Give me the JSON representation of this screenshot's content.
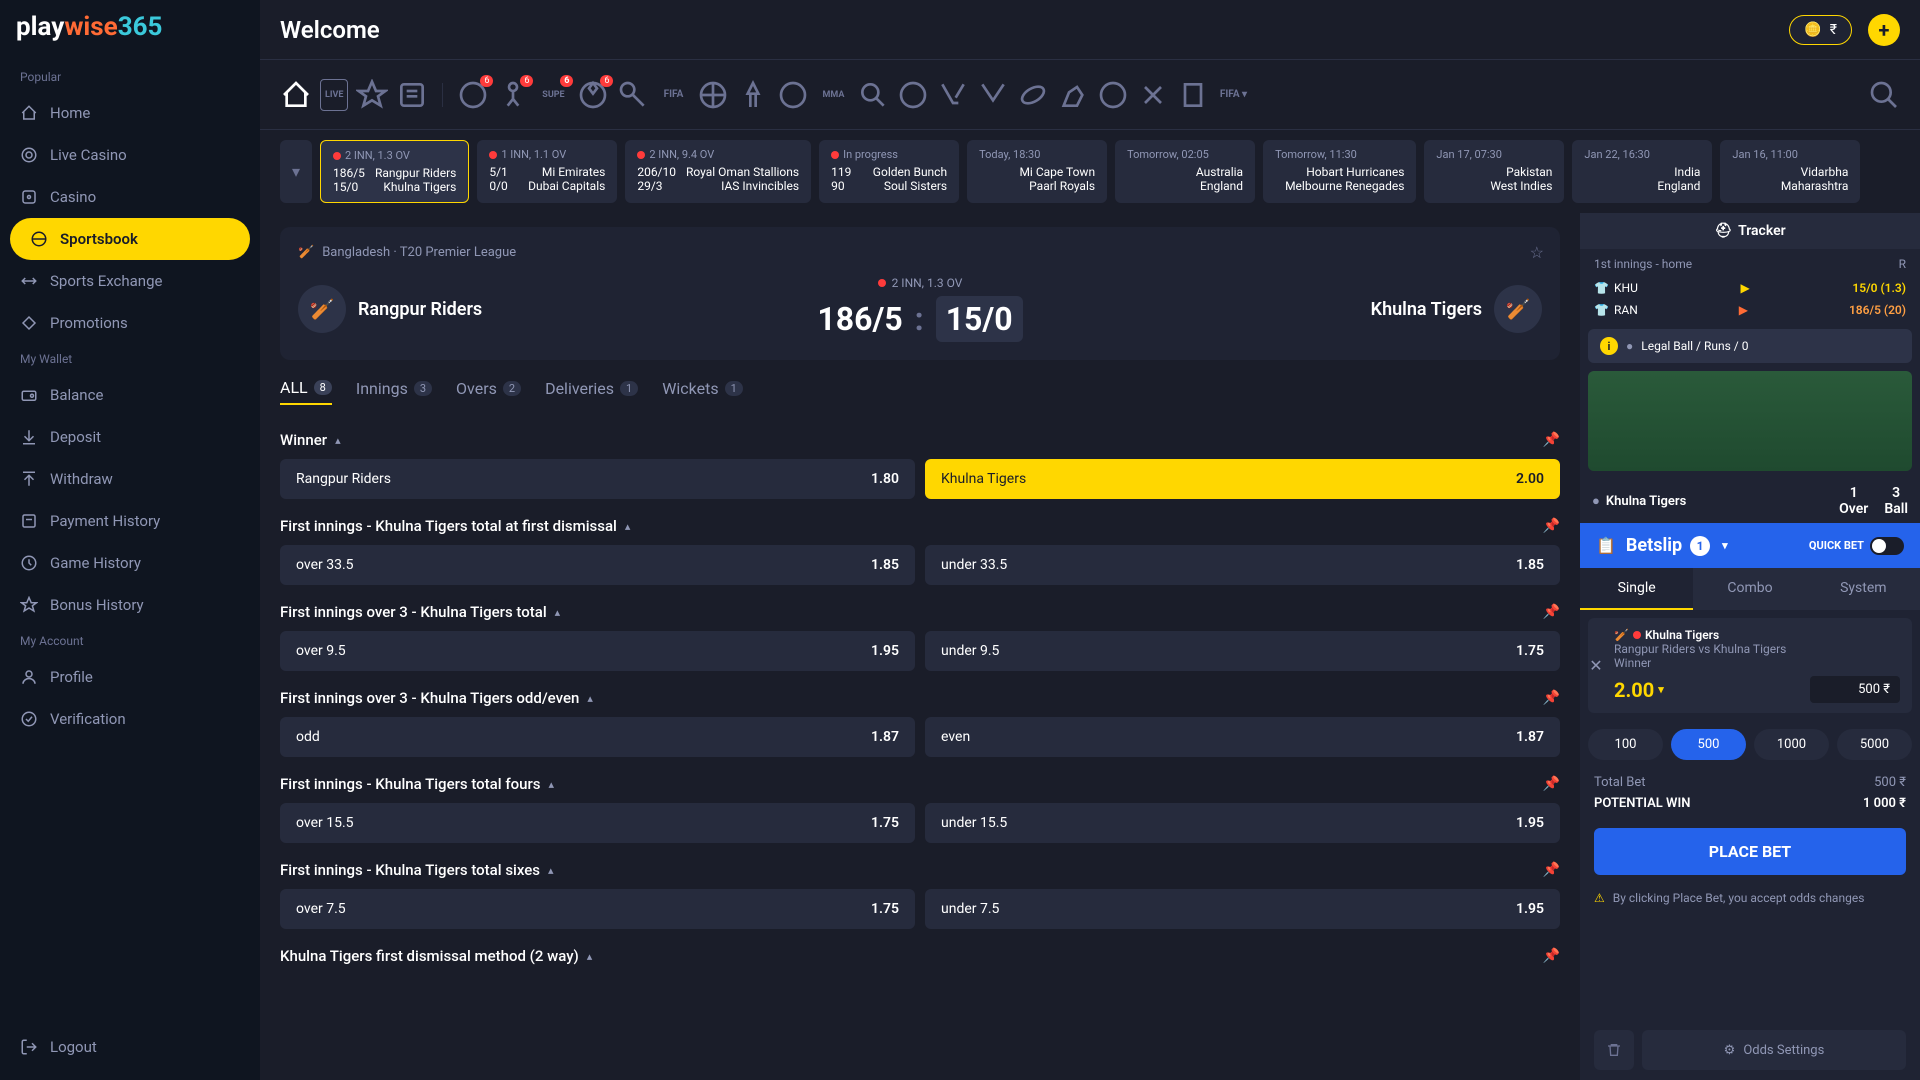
{
  "brand": {
    "play": "play",
    "wise": "wise",
    "num": "365"
  },
  "topbar": {
    "welcome": "Welcome",
    "currency": "₹"
  },
  "sidebar": {
    "popular_label": "Popular",
    "wallet_label": "My Wallet",
    "account_label": "My Account",
    "items_popular": [
      "Home",
      "Live Casino",
      "Casino",
      "Sportsbook",
      "Sports Exchange",
      "Promotions"
    ],
    "items_wallet": [
      "Balance",
      "Deposit",
      "Withdraw",
      "Payment History",
      "Game History",
      "Bonus History"
    ],
    "items_account": [
      "Profile",
      "Verification"
    ],
    "logout": "Logout"
  },
  "sport_badges": [
    "6",
    "6",
    "6",
    "6"
  ],
  "strip": [
    {
      "top": "2 INN, 1.3 OV",
      "l": [
        "186/5",
        "15/0"
      ],
      "r": [
        "Rangpur Riders",
        "Khulna Tigers"
      ],
      "live": true
    },
    {
      "top": "1 INN, 1.1 OV",
      "l": [
        "5/1",
        "0/0"
      ],
      "r": [
        "Mi Emirates",
        "Dubai Capitals"
      ],
      "live": true
    },
    {
      "top": "2 INN, 9.4 OV",
      "l": [
        "206/10",
        "29/3"
      ],
      "r": [
        "Royal Oman Stallions",
        "IAS Invincibles"
      ],
      "live": true
    },
    {
      "top": "In progress",
      "l": [
        "119",
        "90"
      ],
      "r": [
        "Golden Bunch",
        "Soul Sisters"
      ],
      "live": true
    },
    {
      "top": "Today, 18:30",
      "l": [
        "",
        ""
      ],
      "r": [
        "Mi Cape Town",
        "Paarl Royals"
      ]
    },
    {
      "top": "Tomorrow, 02:05",
      "l": [
        "",
        ""
      ],
      "r": [
        "Australia",
        "England"
      ]
    },
    {
      "top": "Tomorrow, 11:30",
      "l": [
        "",
        ""
      ],
      "r": [
        "Hobart Hurricanes",
        "Melbourne Renegades"
      ]
    },
    {
      "top": "Jan 17, 07:30",
      "l": [
        "",
        ""
      ],
      "r": [
        "Pakistan",
        "West Indies"
      ]
    },
    {
      "top": "Jan 22, 16:30",
      "l": [
        "",
        ""
      ],
      "r": [
        "India",
        "England"
      ]
    },
    {
      "top": "Jan 16, 11:00",
      "l": [
        "",
        ""
      ],
      "r": [
        "Vidarbha",
        "Maharashtra"
      ]
    }
  ],
  "match": {
    "league": "Bangladesh · T20 Premier League",
    "home": "Rangpur Riders",
    "away": "Khulna Tigers",
    "over": "2 INN, 1.3 OV",
    "score_a": "186/5",
    "score_b": "15/0"
  },
  "tabs": [
    {
      "label": "ALL",
      "count": "8"
    },
    {
      "label": "Innings",
      "count": "3"
    },
    {
      "label": "Overs",
      "count": "2"
    },
    {
      "label": "Deliveries",
      "count": "1"
    },
    {
      "label": "Wickets",
      "count": "1"
    }
  ],
  "markets": [
    {
      "name": "Winner",
      "sel": [
        {
          "n": "Rangpur Riders",
          "o": "1.80"
        },
        {
          "n": "Khulna Tigers",
          "o": "2.00",
          "selected": true
        }
      ]
    },
    {
      "name": "First innings - Khulna Tigers total at first dismissal",
      "sel": [
        {
          "n": "over 33.5",
          "o": "1.85"
        },
        {
          "n": "under 33.5",
          "o": "1.85"
        }
      ]
    },
    {
      "name": "First innings over 3 - Khulna Tigers total",
      "sel": [
        {
          "n": "over 9.5",
          "o": "1.95"
        },
        {
          "n": "under 9.5",
          "o": "1.75"
        }
      ]
    },
    {
      "name": "First innings over 3 - Khulna Tigers odd/even",
      "sel": [
        {
          "n": "odd",
          "o": "1.87"
        },
        {
          "n": "even",
          "o": "1.87"
        }
      ]
    },
    {
      "name": "First innings - Khulna Tigers total fours",
      "sel": [
        {
          "n": "over 15.5",
          "o": "1.75"
        },
        {
          "n": "under 15.5",
          "o": "1.95"
        }
      ]
    },
    {
      "name": "First innings - Khulna Tigers total sixes",
      "sel": [
        {
          "n": "over 7.5",
          "o": "1.75"
        },
        {
          "n": "under 7.5",
          "o": "1.95"
        }
      ]
    },
    {
      "name": "Khulna Tigers first dismissal method (2 way)",
      "sel": []
    }
  ],
  "tracker": {
    "title": "Tracker",
    "innings_label": "1st innings - home",
    "r_label": "R",
    "rows": [
      {
        "t": "KHU",
        "s": "15/0 (1.3)"
      },
      {
        "t": "RAN",
        "s": "186/5 (20)",
        "high": true
      }
    ],
    "banner": "Legal Ball  / Runs  / 0",
    "batting": "Khulna Tigers",
    "over_lbl": "Over",
    "over_val": "1",
    "ball_lbl": "Ball",
    "ball_val": "3"
  },
  "betslip": {
    "title": "Betslip",
    "count": "1",
    "quick": "QUICK BET",
    "tabs": [
      "Single",
      "Combo",
      "System"
    ],
    "item": {
      "team": "Khulna Tigers",
      "match": "Rangpur Riders vs Khulna Tigers",
      "market": "Winner",
      "odds": "2.00",
      "stake": "500 ₹"
    },
    "chips": [
      "100",
      "500",
      "1000",
      "5000"
    ],
    "active_chip": 1,
    "total_bet_lbl": "Total Bet",
    "total_bet": "500 ₹",
    "potential_lbl": "POTENTIAL WIN",
    "potential": "1 000 ₹",
    "place": "PLACE BET",
    "disclaimer": "By clicking Place Bet, you accept odds changes",
    "settings": "Odds Settings"
  }
}
